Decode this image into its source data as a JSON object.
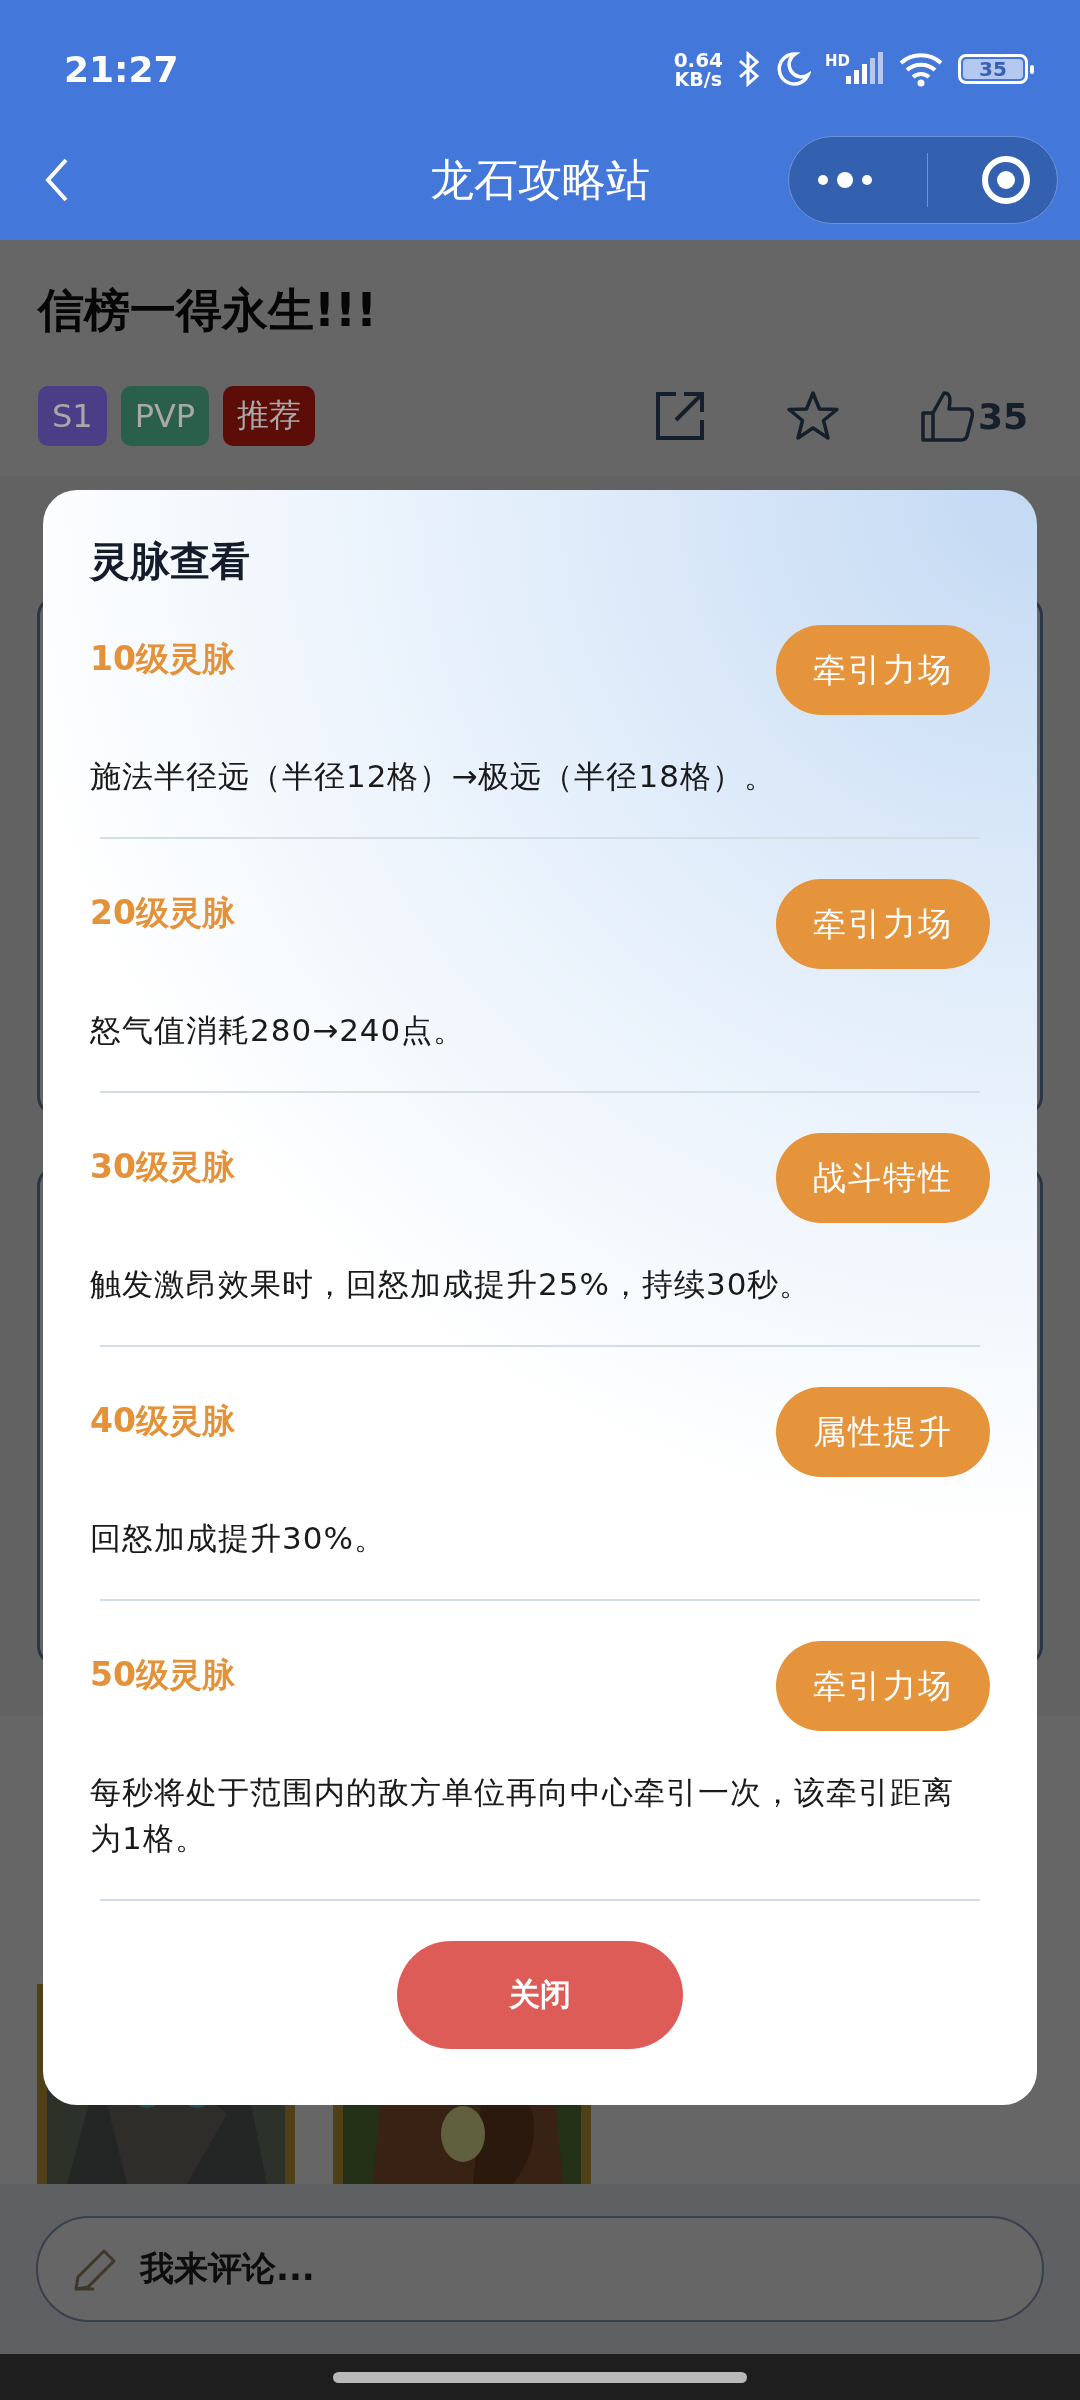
{
  "status_bar": {
    "time": "21:27",
    "net_speed": "0.64",
    "net_unit": "KB/s",
    "network": "HD",
    "battery": "35"
  },
  "nav": {
    "title": "龙石攻略站"
  },
  "post": {
    "title": "信榜一得永生!!!",
    "likes": "35",
    "tags": [
      {
        "label": "S1",
        "color": "#4b3d86"
      },
      {
        "label": "PVP",
        "color": "#2a5f4b"
      },
      {
        "label": "推荐",
        "color": "#5c0d08"
      }
    ]
  },
  "modal": {
    "title": "灵脉查看",
    "close": "关闭",
    "entries": [
      {
        "level": "10级灵脉",
        "tag": "牵引力场",
        "text": "施法半径远（半径12格）→极远（半径18格）。"
      },
      {
        "level": "20级灵脉",
        "tag": "牵引力场",
        "text": "怒气值消耗280→240点。"
      },
      {
        "level": "30级灵脉",
        "tag": "战斗特性",
        "text": "触发激昂效果时，回怒加成提升25%，持续30秒。"
      },
      {
        "level": "40级灵脉",
        "tag": "属性提升",
        "text": "回怒加成提升30%。"
      },
      {
        "level": "50级灵脉",
        "tag": "牵引力场",
        "text": "每秒将处于范围内的敌方单位再向中心牵引一次，该牵引距离为1格。"
      }
    ]
  },
  "comment": {
    "placeholder": "我来评论..."
  }
}
